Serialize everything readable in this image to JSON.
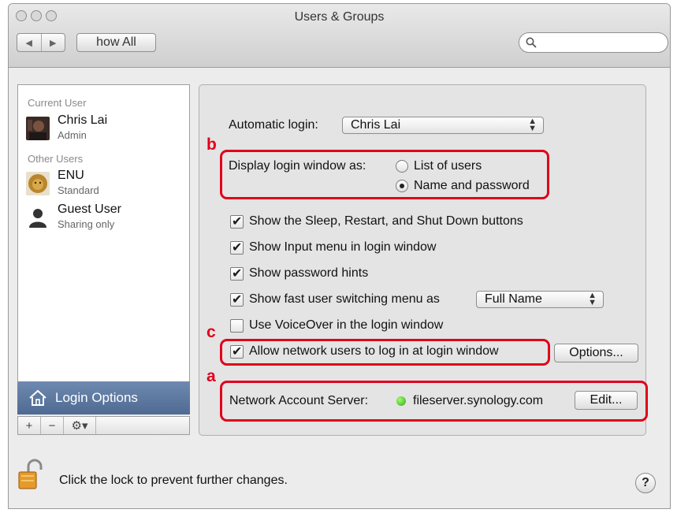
{
  "window": {
    "title": "Users & Groups"
  },
  "toolbar": {
    "back_glyph": "◀",
    "forward_glyph": "▶",
    "show_all_label": "how All",
    "search_placeholder": ""
  },
  "sidebar": {
    "current_user_header": "Current User",
    "current_user": {
      "name": "Chris Lai",
      "role": "Admin",
      "avatar_icon": "user-photo-icon"
    },
    "other_users_header": "Other Users",
    "other_users": [
      {
        "name": "ENU",
        "role": "Standard",
        "avatar_icon": "lion-avatar-icon"
      },
      {
        "name": "Guest User",
        "role": "Sharing only",
        "avatar_icon": "person-silhouette-icon"
      }
    ],
    "login_options_label": "Login Options",
    "tools": {
      "add": "+",
      "remove": "−",
      "action": "⚙▾"
    }
  },
  "panel": {
    "automatic_login_label": "Automatic login:",
    "automatic_login_value": "Chris Lai",
    "display_login_label": "Display login window as:",
    "radio_list_users": "List of users",
    "radio_name_password": "Name and password",
    "radio_selected": "Name and password",
    "checks": [
      {
        "label": "Show the Sleep, Restart, and Shut Down buttons",
        "checked": true
      },
      {
        "label": "Show Input menu in login window",
        "checked": true
      },
      {
        "label": "Show password hints",
        "checked": true
      },
      {
        "label": "Show fast user switching menu as",
        "checked": true
      },
      {
        "label": "Use VoiceOver in the login window",
        "checked": false
      },
      {
        "label": "Allow network users to log in at login window",
        "checked": true
      }
    ],
    "fast_switch_value": "Full Name",
    "options_button": "Options...",
    "network_server_label": "Network Account Server:",
    "network_server_value": "fileserver.synology.com",
    "edit_button": "Edit...",
    "markers": {
      "a": "a",
      "b": "b",
      "c": "c"
    }
  },
  "footer": {
    "lock_text": "Click the lock to prevent further changes.",
    "help_label": "?"
  },
  "colors": {
    "annotation_red": "#e0001b",
    "selection_blue": "#5b78a2",
    "status_green": "#35a61b"
  }
}
